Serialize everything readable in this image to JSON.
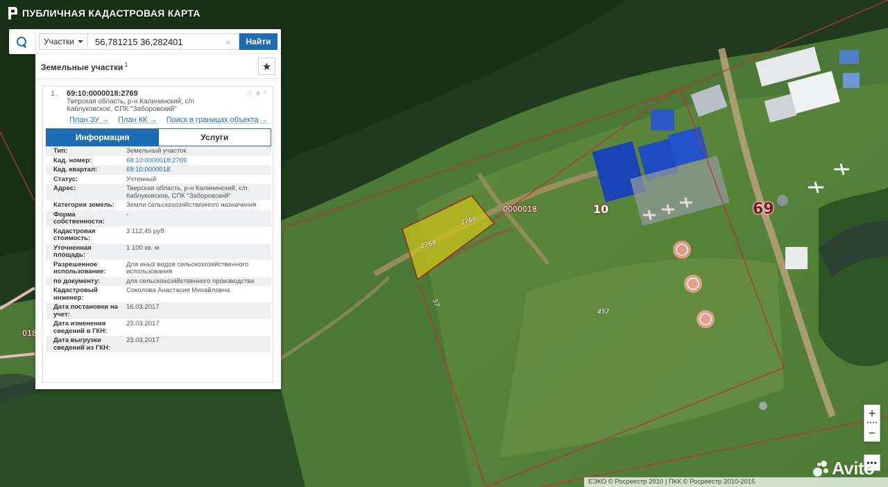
{
  "header": {
    "title": "ПУБЛИЧНАЯ КАДАСТРОВАЯ КАРТА"
  },
  "search": {
    "type_label": "Участки",
    "value": "56,781215 36,282401",
    "clear_symbol": "×",
    "button_label": "Найти"
  },
  "panel": {
    "title": "Земельные участки",
    "count": "1",
    "fav_symbol": "★",
    "result": {
      "index": "1.",
      "id": "69:10:0000018:2769",
      "address": "Тверская область, р-н Калининский, с/п Каблуковское, СПК \"Заборовский\"",
      "icons": "⚠★^",
      "links": [
        "План ЗУ →",
        "План КК →",
        "Поиск в границах объекта →"
      ],
      "tabs": [
        "Информация",
        "Услуги"
      ],
      "rows": [
        {
          "key": "Тип:",
          "value": "Земельный участок"
        },
        {
          "key": "Кад. номер:",
          "value": "69:10:0000018:2769"
        },
        {
          "key": "Кад. квартал:",
          "value": "69:10:0000018"
        },
        {
          "key": "Статус:",
          "value": "Учтенный"
        },
        {
          "key": "Адрес:",
          "value": "Тверская область, р-н Калининский, с/п Каблуковское, СПК \"Заборовский\""
        },
        {
          "key": "Категория земель:",
          "value": "Земли сельскохозяйственного назначения"
        },
        {
          "key": "Форма собственности:",
          "value": "-"
        },
        {
          "key": "Кадастровая стоимость:",
          "value": "3 112,45 руб."
        },
        {
          "key": "Уточненная площадь:",
          "value": "1 100 кв. м"
        },
        {
          "key": "Разрешенное использование:",
          "value": "Для иных видов сельскохозяйственного использования"
        },
        {
          "key": "по документу:",
          "value": "для сельскохозяйственного производства"
        },
        {
          "key": "Кадастровый инженер:",
          "value": "Соколова Анастасия Михайловна"
        },
        {
          "key": "Дата постановки на учет:",
          "value": "16.03.2017"
        },
        {
          "key": "Дата изменения сведений в ГКН:",
          "value": "23.03.2017"
        },
        {
          "key": "Дата выгрузки сведений из ГКН:",
          "value": "23.03.2017"
        }
      ]
    }
  },
  "map": {
    "labels": {
      "parcel_a": "2769",
      "parcel_b": "2769",
      "quarter": "0000018",
      "block_10": "10",
      "district_69": "69",
      "lot_457": "457",
      "lot_57": "57",
      "left_edge": "018"
    },
    "zoom_in": "+",
    "zoom_out": "−",
    "more": "•••",
    "copyright": "ЕЭКО © Росреестр 2010 | ПКК © Росреестр 2010-2015",
    "watermark": "Avito"
  }
}
